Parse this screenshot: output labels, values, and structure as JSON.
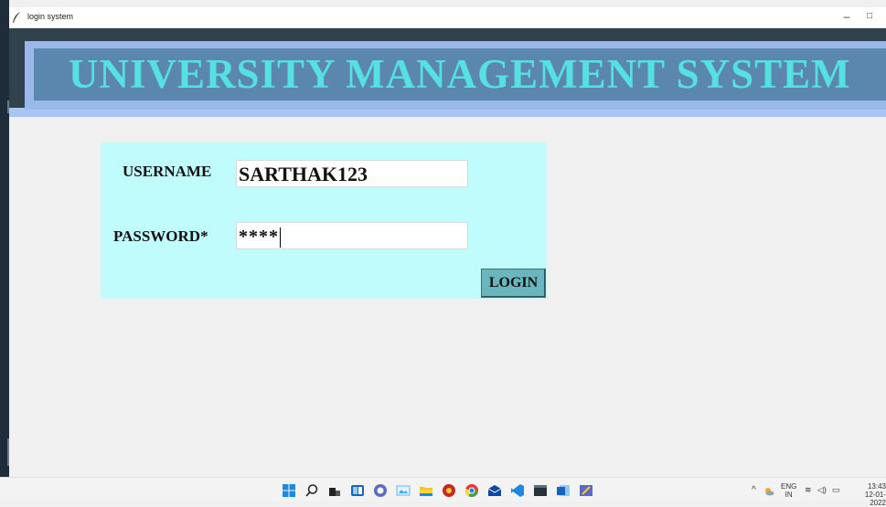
{
  "window": {
    "title": "login system",
    "controls": {
      "minimize": "–",
      "maximize": "□",
      "close": "×"
    }
  },
  "banner": {
    "title": "UNIVERSITY MANAGEMENT SYSTEM"
  },
  "form": {
    "username_label": "USERNAME",
    "username_value": "SARTHAK123",
    "password_label": "PASSWORD*",
    "password_masked": "****",
    "login_label": "LOGIN"
  },
  "taskbar": {
    "icons": [
      "windows-start",
      "search",
      "task-view",
      "widgets",
      "chat",
      "photos",
      "file-explorer",
      "app",
      "chrome",
      "mail",
      "vscode",
      "terminal",
      "word",
      "tkinter-app"
    ],
    "tray": {
      "lang_top": "ENG",
      "lang_bottom": "IN",
      "time": "13:43",
      "date": "12-01-2022"
    }
  },
  "colors": {
    "banner_text": "#55e0e2",
    "panel_bg": "#c0fcfc",
    "button_bg": "#6ab6bf"
  }
}
